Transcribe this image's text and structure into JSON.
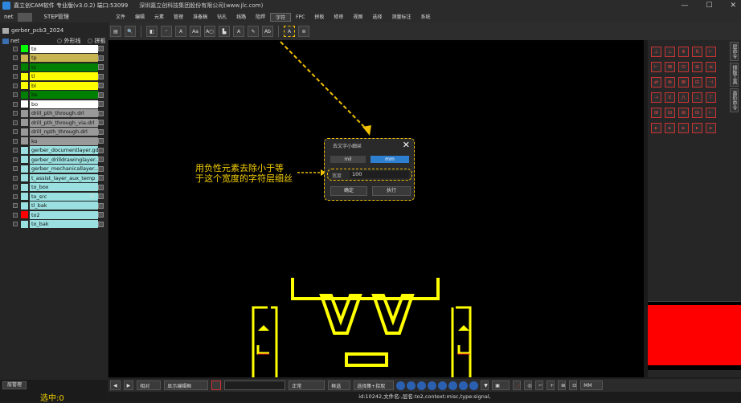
{
  "titlebar": {
    "title": "嘉立创CAM软件 专业版(v3.0.2) 端口:53099",
    "company": "深圳嘉立创科技集团股份有限公司(www.jlc.com)",
    "minimize": "—",
    "maximize": "☐",
    "close": "✕"
  },
  "menubar": {
    "tabs": [
      "net",
      "",
      "STEP管理"
    ],
    "menus": [
      "文件",
      "编辑",
      "元素",
      "管理",
      "准备稿",
      "钻孔",
      "线路",
      "阻焊",
      "字符",
      "FPC",
      "拼板",
      "修审",
      "视图",
      "选择",
      "测量标注",
      "系统"
    ],
    "active_menu": "字符"
  },
  "leftpanel": {
    "project": "gerber_pcb3_2024",
    "net_label": "net",
    "outline_label": "外形线",
    "panel_label": "拼板",
    "layers": [
      {
        "name": "to",
        "swatch": "#00ff00",
        "bg": "#ffffff",
        "o": ""
      },
      {
        "name": "tp",
        "swatch": "#c8b450",
        "bg": "#c8b450",
        "o": ""
      },
      {
        "name": "ts",
        "swatch": "#008000",
        "bg": "#008000",
        "o": ""
      },
      {
        "name": "tl",
        "swatch": "#ffff00",
        "bg": "#ffff00",
        "o": ""
      },
      {
        "name": "bl",
        "swatch": "#ffff00",
        "bg": "#ffff00",
        "o": ""
      },
      {
        "name": "bs",
        "swatch": "#008000",
        "bg": "#008000",
        "o": ""
      },
      {
        "name": "bo",
        "swatch": "#ffffff",
        "bg": "#ffffff",
        "o": ""
      },
      {
        "name": "drill_pth_through.drl",
        "swatch": "#999999",
        "bg": "#999999",
        "o": ""
      },
      {
        "name": "drill_pth_through_via.drl",
        "swatch": "#999999",
        "bg": "#999999",
        "o": ""
      },
      {
        "name": "drill_npth_through.drl",
        "swatch": "#999999",
        "bg": "#999999",
        "o": ""
      },
      {
        "name": "ko",
        "swatch": "#999999",
        "bg": "#999999",
        "o": ""
      },
      {
        "name": "gerber_documentlayer.gdl",
        "swatch": "#9be0e0",
        "bg": "#9be0e0",
        "o": ""
      },
      {
        "name": "gerber_drilldrawinglayer...",
        "swatch": "#9be0e0",
        "bg": "#9be0e0",
        "o": ""
      },
      {
        "name": "gerber_mechanicallayer...",
        "swatch": "#9be0e0",
        "bg": "#9be0e0",
        "o": ""
      },
      {
        "name": "t_assist_layer_aux_temp",
        "swatch": "#9be0e0",
        "bg": "#9be0e0",
        "o": ""
      },
      {
        "name": "to_box",
        "swatch": "#9be0e0",
        "bg": "#9be0e0",
        "o": ""
      },
      {
        "name": "to_src",
        "swatch": "#9be0e0",
        "bg": "#9be0e0",
        "o": "O"
      },
      {
        "name": "tl_bak",
        "swatch": "#9be0e0",
        "bg": "#9be0e0",
        "o": ""
      },
      {
        "name": "to2",
        "swatch": "#ff0000",
        "bg": "#9be0e0",
        "o": ""
      },
      {
        "name": "to_bak",
        "swatch": "#9be0e0",
        "bg": "#9be0e0",
        "o": ""
      }
    ],
    "layer_mgmt": "层管理",
    "selected": "选中:0"
  },
  "toolbar": {
    "buttons": [
      "▤",
      "🔍",
      "◧",
      "◜",
      "A",
      "Aa",
      "A▢",
      "▙",
      "A",
      "✎",
      "Ab",
      "A",
      "⊚"
    ]
  },
  "dialog": {
    "title": "去文字小细丝",
    "unit_mil": "mil",
    "unit_mm": "mm",
    "width_label": "宽度",
    "width_value": "100",
    "ok": "确定",
    "run": "执行"
  },
  "annotation": {
    "line1": "用负性元素去除小于等",
    "line2": "于这个宽度的字符层细丝"
  },
  "rightpanel": {
    "vtabs": [
      "层命令",
      "排板工具",
      "高阶命令"
    ],
    "icons": [
      "⊥",
      "⊥",
      "⋔",
      "⇅",
      "⊢",
      "⊢",
      "⊠",
      "⊡",
      "⊕",
      "≡",
      "⇄",
      "⊗",
      "⊠",
      "⊟",
      "⊣",
      "⇢",
      "⊻",
      "⋀",
      "⊥",
      "⊤",
      "⊞",
      "⊟",
      "⊞",
      "⊟",
      "⊢",
      "▸",
      "▸",
      "▸",
      "▸",
      "▸"
    ]
  },
  "bottombar": {
    "mode": "相对",
    "window_mgmt": "显示编辑框",
    "style": "正常",
    "snap": "框选",
    "select_all": "选择集+拾取",
    "unit": "MM"
  },
  "status": "id:10242,文件名:,层名:to2,context:misc,type:signal,"
}
